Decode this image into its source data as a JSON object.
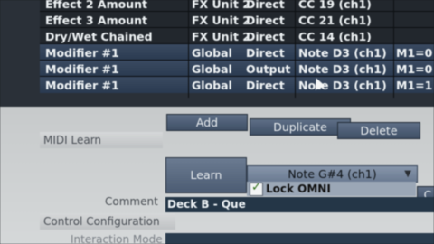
{
  "table": {
    "rows": [
      {
        "name": "Effect 2 Amount",
        "unit": "FX Unit 2",
        "mode": "Direct",
        "control": "CC 19 (ch1)",
        "value": ""
      },
      {
        "name": "Effect 3 Amount",
        "unit": "FX Unit 2",
        "mode": "Direct",
        "control": "CC 21 (ch1)",
        "value": ""
      },
      {
        "name": "Dry/Wet Chained",
        "unit": "FX Unit 2",
        "mode": "Direct",
        "control": "CC 14 (ch1)",
        "value": ""
      },
      {
        "name": "Modifier #1",
        "unit": "Global",
        "mode": "Direct",
        "control": "Note D3 (ch1)",
        "value": "M1=0"
      },
      {
        "name": "Modifier #1",
        "unit": "Global",
        "mode": "Output",
        "control": "Note D3 (ch1)",
        "value": "M1=0"
      },
      {
        "name": "Modifier #1",
        "unit": "Global",
        "mode": "Direct",
        "control": "Note D3 (ch1)",
        "value": "M1=1"
      }
    ]
  },
  "actions": {
    "add": "Add",
    "duplicate": "Duplicate",
    "delete": "Delete"
  },
  "midi_learn": {
    "section_label": "MIDI Learn",
    "learn_button": "Learn",
    "assignment": "Note G#4 (ch1)",
    "lock_omni_label": "Lock OMNI",
    "side_button": "C"
  },
  "comment": {
    "label": "Comment",
    "value": "Deck B - Que"
  },
  "control_configuration": {
    "section_label": "Control Configuration",
    "interaction_mode_label": "Interaction Mode"
  }
}
